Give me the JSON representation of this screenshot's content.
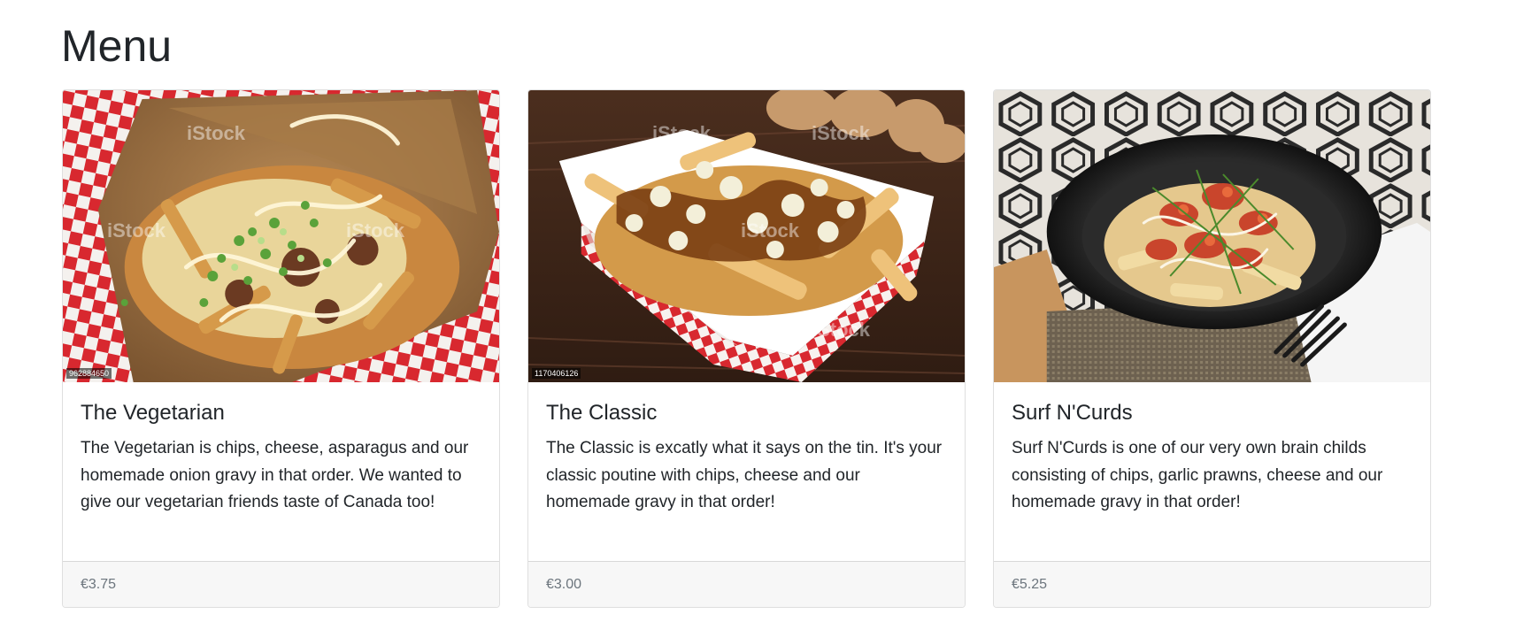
{
  "page": {
    "title": "Menu"
  },
  "cards": [
    {
      "title": "The Vegetarian",
      "description": "The Vegetarian is chips, cheese, asparagus and our homemade onion gravy in that order. We wanted to give our vegetarian friends taste of Canada too!",
      "price": "€3.75",
      "image_alt": "Vegetarian poutine in a paper box on red checkered paper",
      "image_id": "962884650",
      "watermark": "iStock"
    },
    {
      "title": "The Classic",
      "description": "The Classic is excatly what it says on the tin. It's your classic poutine with chips, cheese and our homemade gravy in that order!",
      "price": "€3.00",
      "image_alt": "Classic poutine with gravy in a red checkered paper tray on wooden board",
      "image_id": "1170406126",
      "watermark": "iStock"
    },
    {
      "title": "Surf N'Curds",
      "description": "Surf N'Curds is one of our very own brain childs consisting of chips, garlic prawns, cheese and our homemade gravy in that order!",
      "price": "€5.25",
      "image_alt": "Prawn poutine in a black bowl with fork on patterned background",
      "watermark": ""
    }
  ],
  "colors": {
    "text": "#212529",
    "muted": "#6c757d",
    "footer_bg": "#f7f7f7",
    "checker_red": "#d8282f"
  }
}
